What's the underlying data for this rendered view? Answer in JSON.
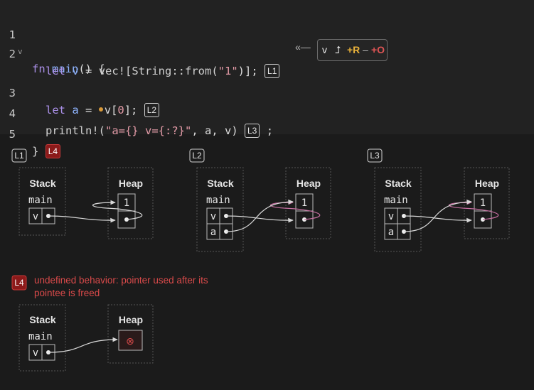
{
  "code": {
    "lines": [
      {
        "num": "1",
        "fold": "v"
      },
      {
        "num": "2"
      },
      {
        "num": "3"
      },
      {
        "num": "4"
      },
      {
        "num": "5"
      }
    ],
    "l1": {
      "kw": "fn",
      "name": "main",
      "rest": "() {"
    },
    "l2": {
      "kw": "let",
      "var": "v",
      "eq": " = ",
      "mac": "vec![String::from(",
      "str": "\"1\"",
      "end": ")];"
    },
    "l3": {
      "kw": "let",
      "var": "a",
      "eq": " = ",
      "expr": "v[",
      "idx": "0",
      "end": "];"
    },
    "l4": {
      "mac": "println!(",
      "str": "\"a={} v={:?}\"",
      "end": ", a, v)",
      "semi": " ;"
    },
    "l5": {
      "brace": "}"
    }
  },
  "badges": {
    "l1": "L1",
    "l2": "L2",
    "l3": "L3",
    "l4": "L4"
  },
  "permissions": {
    "arrow": "«—",
    "var": "v",
    "icon": "⮥",
    "plus_r": "+R",
    "dash": "–",
    "plus_o": "+O"
  },
  "diagram": {
    "stack": "Stack",
    "heap": "Heap",
    "main": "main",
    "v": "v",
    "a": "a",
    "heap_value": "1",
    "freed": "⊗"
  },
  "error": "undefined behavior: pointer used after its pointee is freed",
  "colors": {
    "accent_red": "#8b1a1a",
    "error_text": "#d94a4a",
    "pointer_line": "#d8d8d8",
    "highlight_line": "#c56ea0"
  }
}
